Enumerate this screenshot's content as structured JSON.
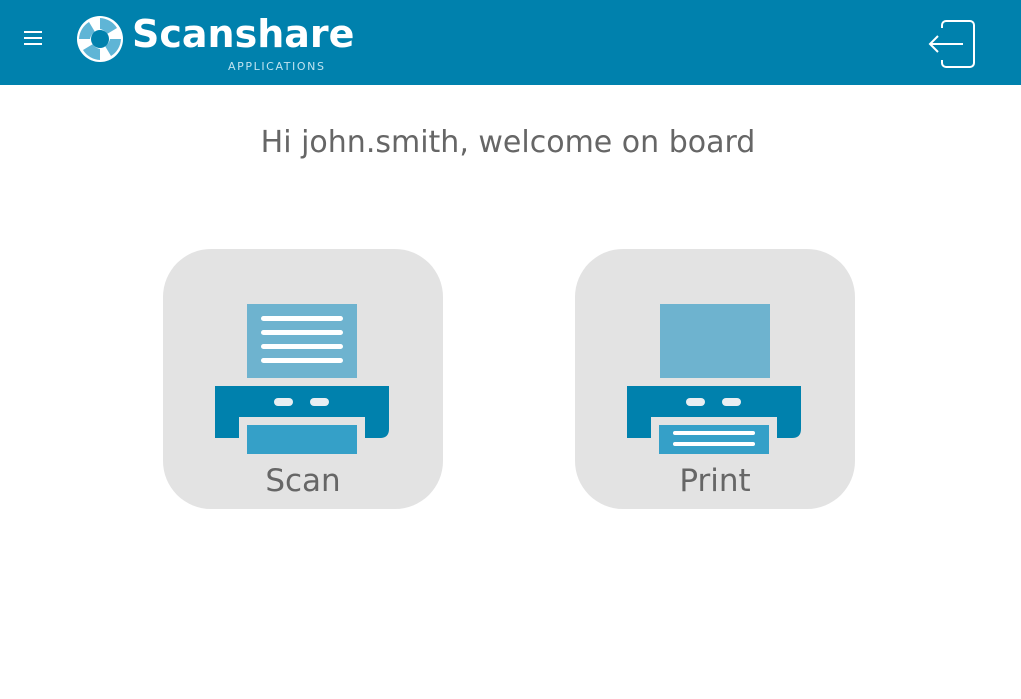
{
  "header": {
    "brand_name": "Scanshare",
    "brand_sub": "APPLICATIONS",
    "menu_icon": "hamburger-menu-icon",
    "logout_icon": "logout-icon"
  },
  "main": {
    "welcome": "Hi john.smith, welcome on board",
    "tiles": [
      {
        "label": "Scan",
        "icon": "scanner-icon"
      },
      {
        "label": "Print",
        "icon": "printer-icon"
      }
    ]
  },
  "colors": {
    "header_bg": "#0081ad",
    "tile_bg": "#e3e3e3",
    "icon_light": "#6eb3cf",
    "icon_dark": "#0081ad",
    "icon_tray": "#35a0c8",
    "text_gray": "#666666"
  }
}
